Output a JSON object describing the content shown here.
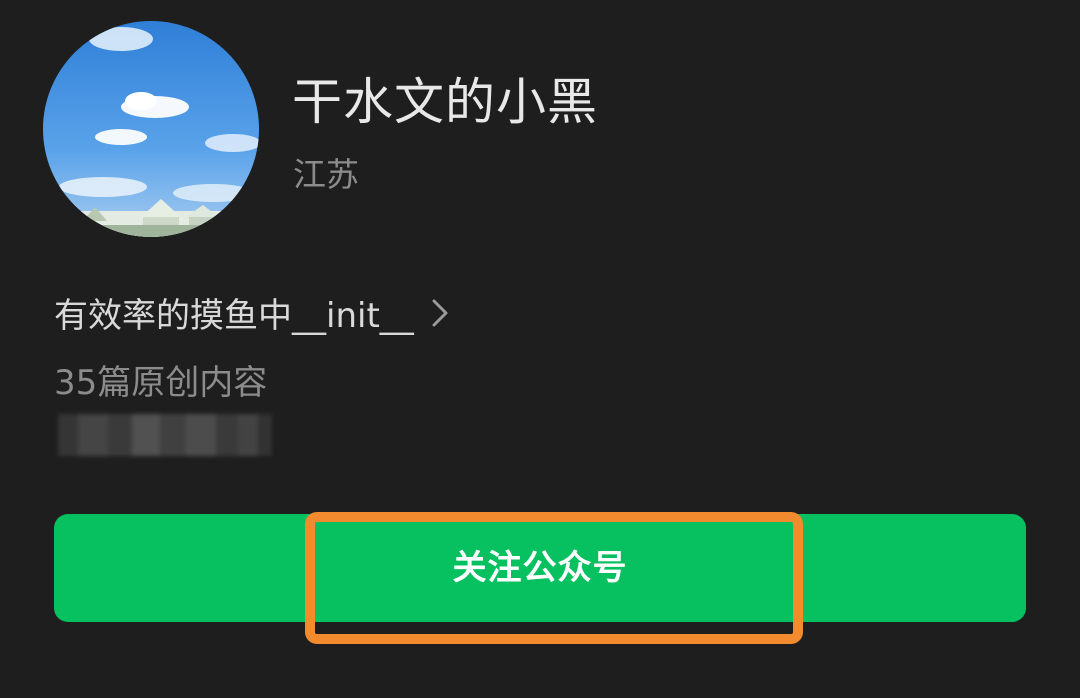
{
  "profile": {
    "name": "干水文的小黑",
    "region": "江苏",
    "bio": "有效率的摸鱼中__init__",
    "article_count": "35篇原创内容"
  },
  "actions": {
    "follow_label": "关注公众号"
  },
  "icons": {
    "bio_more": "chevron-right-icon"
  },
  "colors": {
    "background": "#1e1e1e",
    "button": "#07c160",
    "highlight": "#f28a2e"
  }
}
